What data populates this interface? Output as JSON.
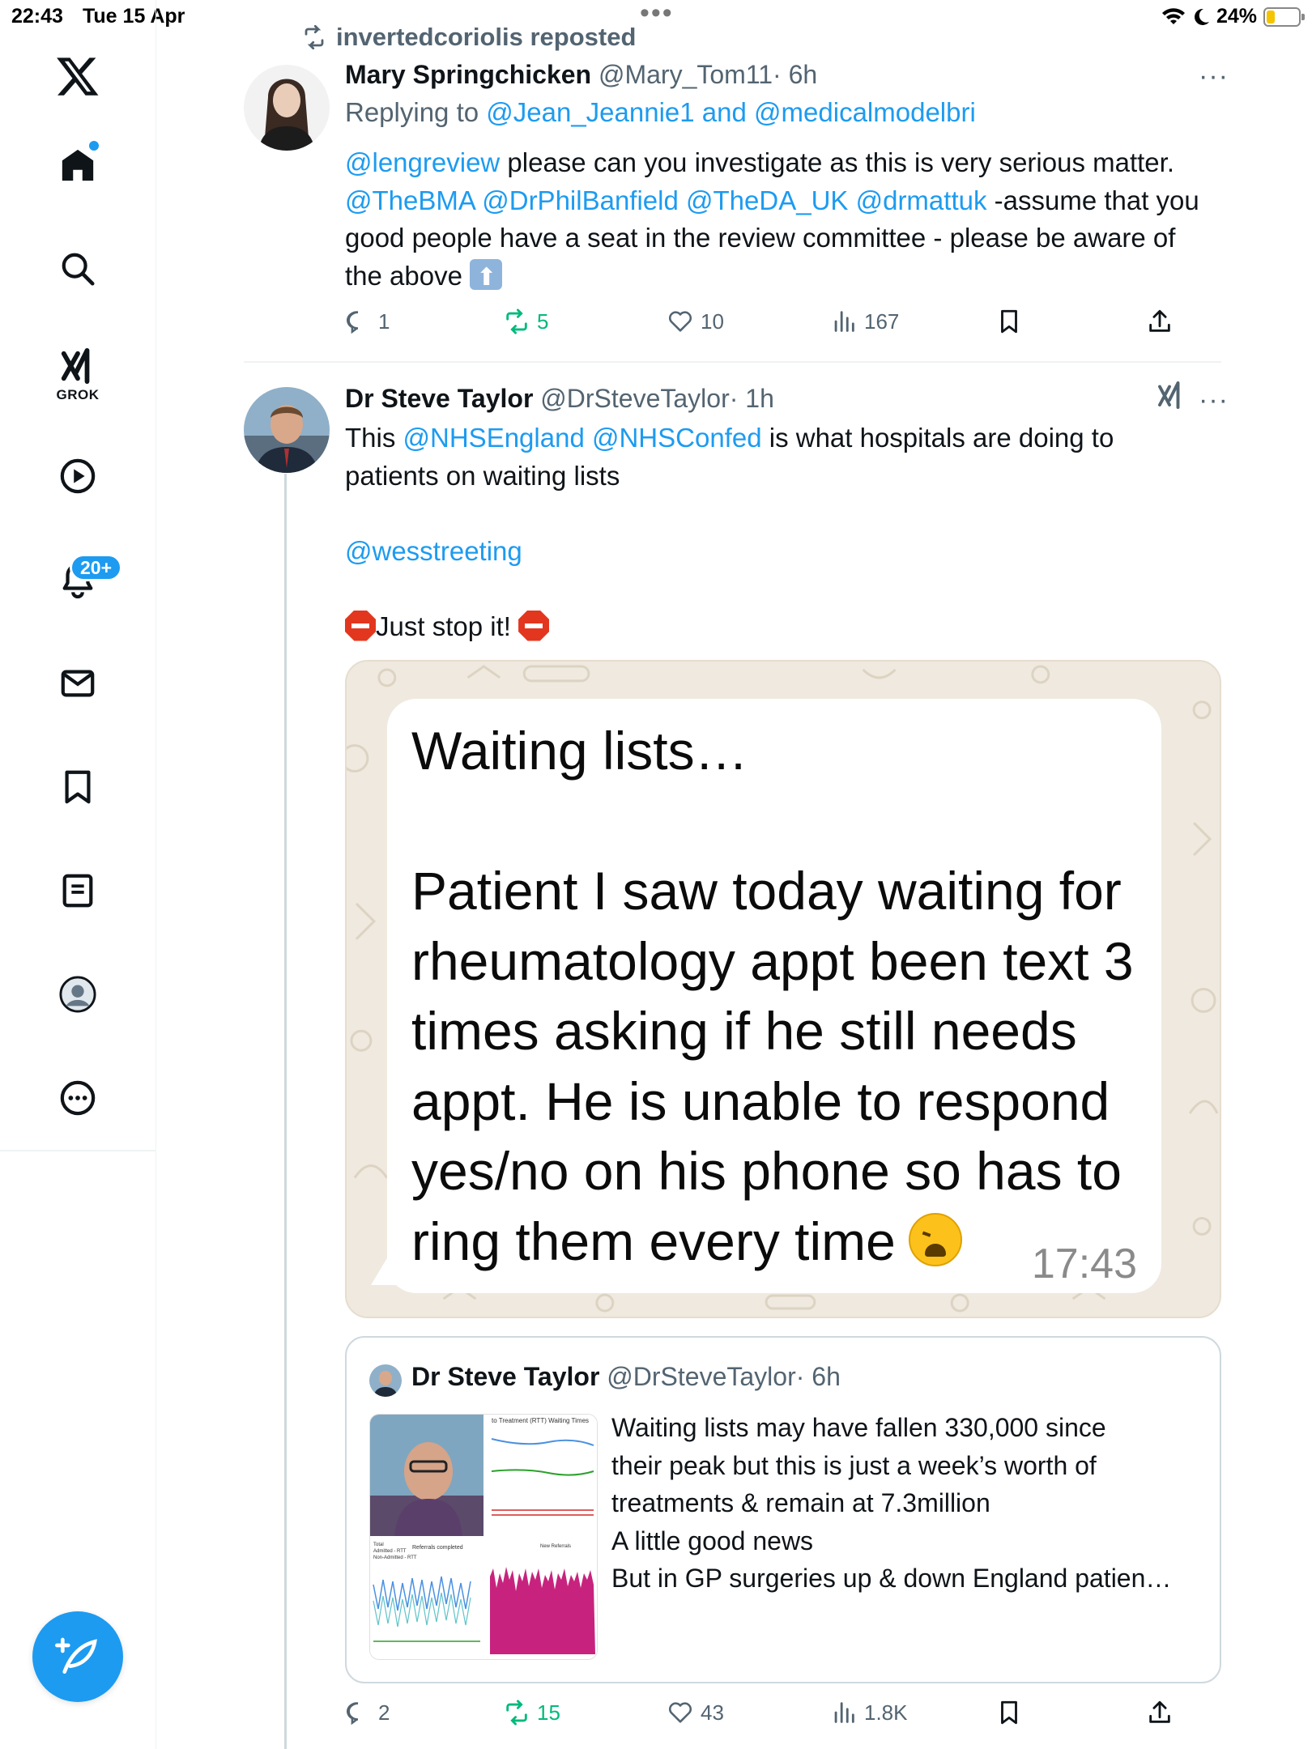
{
  "status_bar": {
    "time": "22:43",
    "date": "Tue 15 Apr",
    "battery": "24%",
    "battery_level": 0.24
  },
  "sidebar": {
    "grok_label": "GROK",
    "notifications_badge": "20+",
    "items": [
      "x-logo",
      "home-icon",
      "search-icon",
      "grok-icon",
      "video-icon",
      "notifications-icon",
      "messages-icon",
      "bookmarks-icon",
      "lists-icon",
      "profile-icon",
      "more-icon"
    ]
  },
  "repost": {
    "label": "invertedcoriolis reposted"
  },
  "tweet1": {
    "name": "Mary Springchicken",
    "handle": "@Mary_Tom11",
    "time": "· 6h",
    "replying_prefix": "Replying to ",
    "replying_user1": "@Jean_Jeannie1",
    "replying_and": " and ",
    "replying_user2": "@medicalmodelbri",
    "mention1": "@lengreview",
    "text1": " please can you investigate as this is very serious matter.",
    "mention2": "@TheBMA",
    "mention3": "@DrPhilBanfield",
    "mention4": "@TheDA_UK",
    "mention5": "@drmattuk",
    "text2": " -assume that you",
    "text3": "good people have a seat in the review committee - please be aware of",
    "text4": "the above ",
    "replies": "1",
    "reposts": "5",
    "likes": "10",
    "views": "167"
  },
  "tweet2": {
    "name": "Dr Steve Taylor",
    "handle": "@DrSteveTaylor",
    "time": "· 1h",
    "line1_prefix": "This ",
    "mention1": "@NHSEngland",
    "mention2": "@NHSConfed",
    "line1_suffix": " is what hospitals are doing to",
    "line2": "patients on waiting lists",
    "mention3": "@wesstreeting",
    "line4": "Just stop it! ",
    "replies": "2",
    "reposts": "15",
    "likes": "43",
    "views": "1.8K"
  },
  "image_message": {
    "title": "Waiting lists…",
    "lines": [
      "Patient I saw today waiting for",
      "rheumatology appt been text 3",
      "times asking if he still needs",
      "appt. He is unable to respond",
      "yes/no on his phone so has to",
      "ring them every time"
    ],
    "timestamp": "17:43"
  },
  "quote": {
    "name": "Dr Steve Taylor",
    "handle": "@DrSteveTaylor",
    "time": "· 6h",
    "lines": [
      "Waiting lists may have fallen 330,000 since",
      "their peak but this is just a week’s worth of",
      "treatments & remain at 7.3million",
      "A little good news",
      "But in GP surgeries up & down England patien…"
    ],
    "media_text": {
      "chart_title": "to Treatment (RTT) Waiting Times",
      "referrals": "Referrals completed",
      "legend": "New Referrals",
      "total": "Total",
      "admitted": "Admitted - RTT",
      "non_admitted": "Non-Admitted - RTT"
    }
  },
  "colors": {
    "accent": "#1d9bf0",
    "repost_green": "#00ba7c",
    "text_gray": "#536471"
  }
}
